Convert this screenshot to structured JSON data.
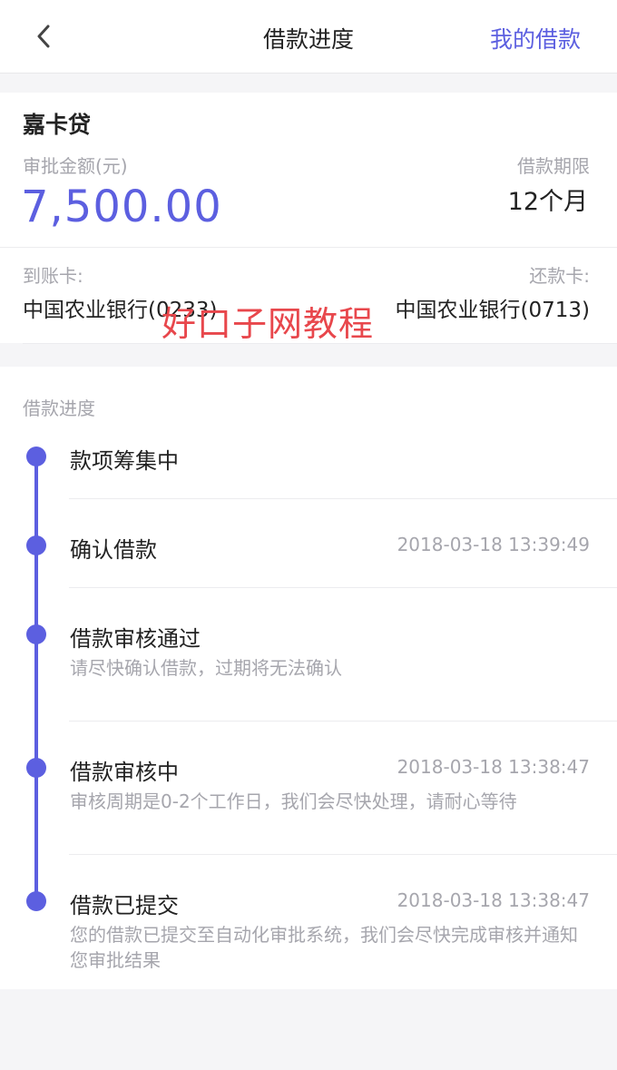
{
  "nav": {
    "title": "借款进度",
    "right_link": "我的借款",
    "back_icon": "chevron-left-icon"
  },
  "loan": {
    "product_name": "嘉卡贷",
    "amount_label": "审批金额(元)",
    "amount": "7,500.00",
    "term_label": "借款期限",
    "term": "12个月",
    "receive_card_label": "到账卡:",
    "receive_card": "中国农业银行(0233)",
    "repay_card_label": "还款卡:",
    "repay_card": "中国农业银行(0713)"
  },
  "watermark": "好口子网教程",
  "progress": {
    "section_title": "借款进度",
    "steps": [
      {
        "title": "款项筹集中",
        "time": "",
        "desc": ""
      },
      {
        "title": "确认借款",
        "time": "2018-03-18 13:39:49",
        "desc": ""
      },
      {
        "title": "借款审核通过",
        "time": "",
        "desc": "请尽快确认借款，过期将无法确认"
      },
      {
        "title": "借款审核中",
        "time": "2018-03-18 13:38:47",
        "desc": "审核周期是0-2个工作日，我们会尽快处理，请耐心等待"
      },
      {
        "title": "借款已提交",
        "time": "2018-03-18 13:38:47",
        "desc": "您的借款已提交至自动化审批系统，我们会尽快完成审核并通知您审批结果"
      }
    ]
  },
  "colors": {
    "accent": "#5c5fe0",
    "text": "#222222",
    "muted": "#a6a6ad",
    "background": "#f5f5f7",
    "watermark": "#e8474c"
  }
}
